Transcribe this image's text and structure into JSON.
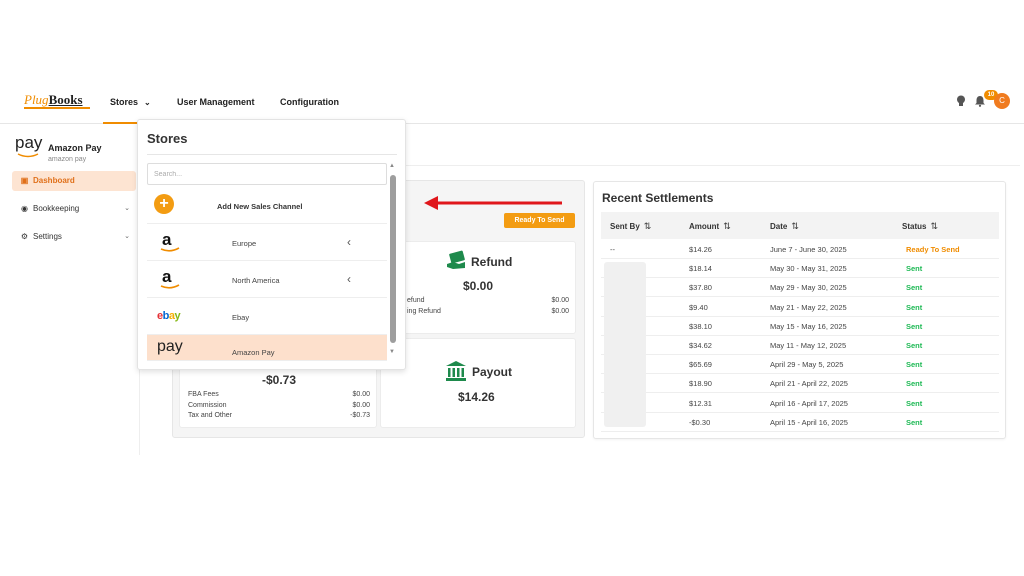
{
  "brand": {
    "logo_plug": "Plug",
    "logo_books": "Books"
  },
  "nav": {
    "stores": "Stores",
    "users": "User Management",
    "config": "Configuration"
  },
  "header": {
    "notif_count": "10",
    "avatar_initial": "C"
  },
  "sidebar": {
    "store_name": "Amazon Pay",
    "store_sub": "amazon pay",
    "pay_logo": "pay",
    "items": [
      {
        "label": "Dashboard"
      },
      {
        "label": "Bookkeeping"
      },
      {
        "label": "Settings"
      }
    ]
  },
  "dropdown": {
    "title": "Stores",
    "search_placeholder": "Search...",
    "add_label": "Add New Sales Channel",
    "rows": [
      {
        "label": "Europe"
      },
      {
        "label": "North America"
      },
      {
        "label": "Ebay"
      },
      {
        "label": "Amazon Pay"
      }
    ]
  },
  "dashboard": {
    "ready_label": "Ready To Send",
    "refund": {
      "title": "Refund",
      "amount": "$0.00",
      "l1": "efund",
      "v1": "$0.00",
      "l2": "ing Refund",
      "v2": "$0.00"
    },
    "fees": {
      "amount": "-$0.73",
      "l1": "FBA Fees",
      "v1": "$0.00",
      "l2": "Commission",
      "v2": "$0.00",
      "l3": "Tax and Other",
      "v3": "-$0.73"
    },
    "payout": {
      "title": "Payout",
      "amount": "$14.26"
    }
  },
  "settlements": {
    "title": "Recent Settlements",
    "headers": {
      "sent_by": "Sent By",
      "amount": "Amount",
      "date": "Date",
      "status": "Status"
    },
    "rows": [
      {
        "sent_by": "--",
        "amount": "$14.26",
        "date": "June 7 - June 30, 2025",
        "status": "Ready To Send"
      },
      {
        "sent_by": "",
        "amount": "$18.14",
        "date": "May 30 - May 31, 2025",
        "status": "Sent"
      },
      {
        "sent_by": "",
        "amount": "$37.80",
        "date": "May 29 - May 30, 2025",
        "status": "Sent"
      },
      {
        "sent_by": "",
        "amount": "$9.40",
        "date": "May 21 - May 22, 2025",
        "status": "Sent"
      },
      {
        "sent_by": "",
        "amount": "$38.10",
        "date": "May 15 - May 16, 2025",
        "status": "Sent"
      },
      {
        "sent_by": "",
        "amount": "$34.62",
        "date": "May 11 - May 12, 2025",
        "status": "Sent"
      },
      {
        "sent_by": "",
        "amount": "$65.69",
        "date": "April 29 - May 5, 2025",
        "status": "Sent"
      },
      {
        "sent_by": "",
        "amount": "$18.90",
        "date": "April 21 - April 22, 2025",
        "status": "Sent"
      },
      {
        "sent_by": "",
        "amount": "$12.31",
        "date": "April 16 - April 17, 2025",
        "status": "Sent"
      },
      {
        "sent_by": "",
        "amount": "-$0.30",
        "date": "April 15 - April 16, 2025",
        "status": "Sent"
      }
    ]
  },
  "colors": {
    "accent": "#f08c00",
    "sent": "#1db954",
    "arrow": "#e0161b"
  },
  "icons": [
    "lightbulb-icon",
    "bell-icon",
    "dashboard-icon",
    "bookkeeping-icon",
    "settings-icon",
    "plus-icon",
    "amazon-icon",
    "ebay-logo",
    "refund-icon",
    "payout-icon"
  ]
}
